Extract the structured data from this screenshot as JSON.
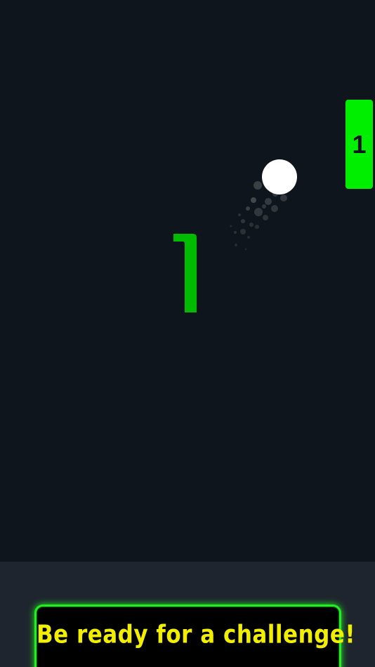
{
  "game": {
    "opponent_paddle_score": "1",
    "player_score": "1"
  },
  "banner": {
    "text": "Be ready for a challenge!"
  },
  "colors": {
    "background": "#0f151c",
    "bottom_bar": "#1f252e",
    "paddle": "#00ee00",
    "score": "#00bb00",
    "ball": "#ffffff",
    "banner_border": "#22ee22",
    "banner_text": "#f2ee00"
  }
}
